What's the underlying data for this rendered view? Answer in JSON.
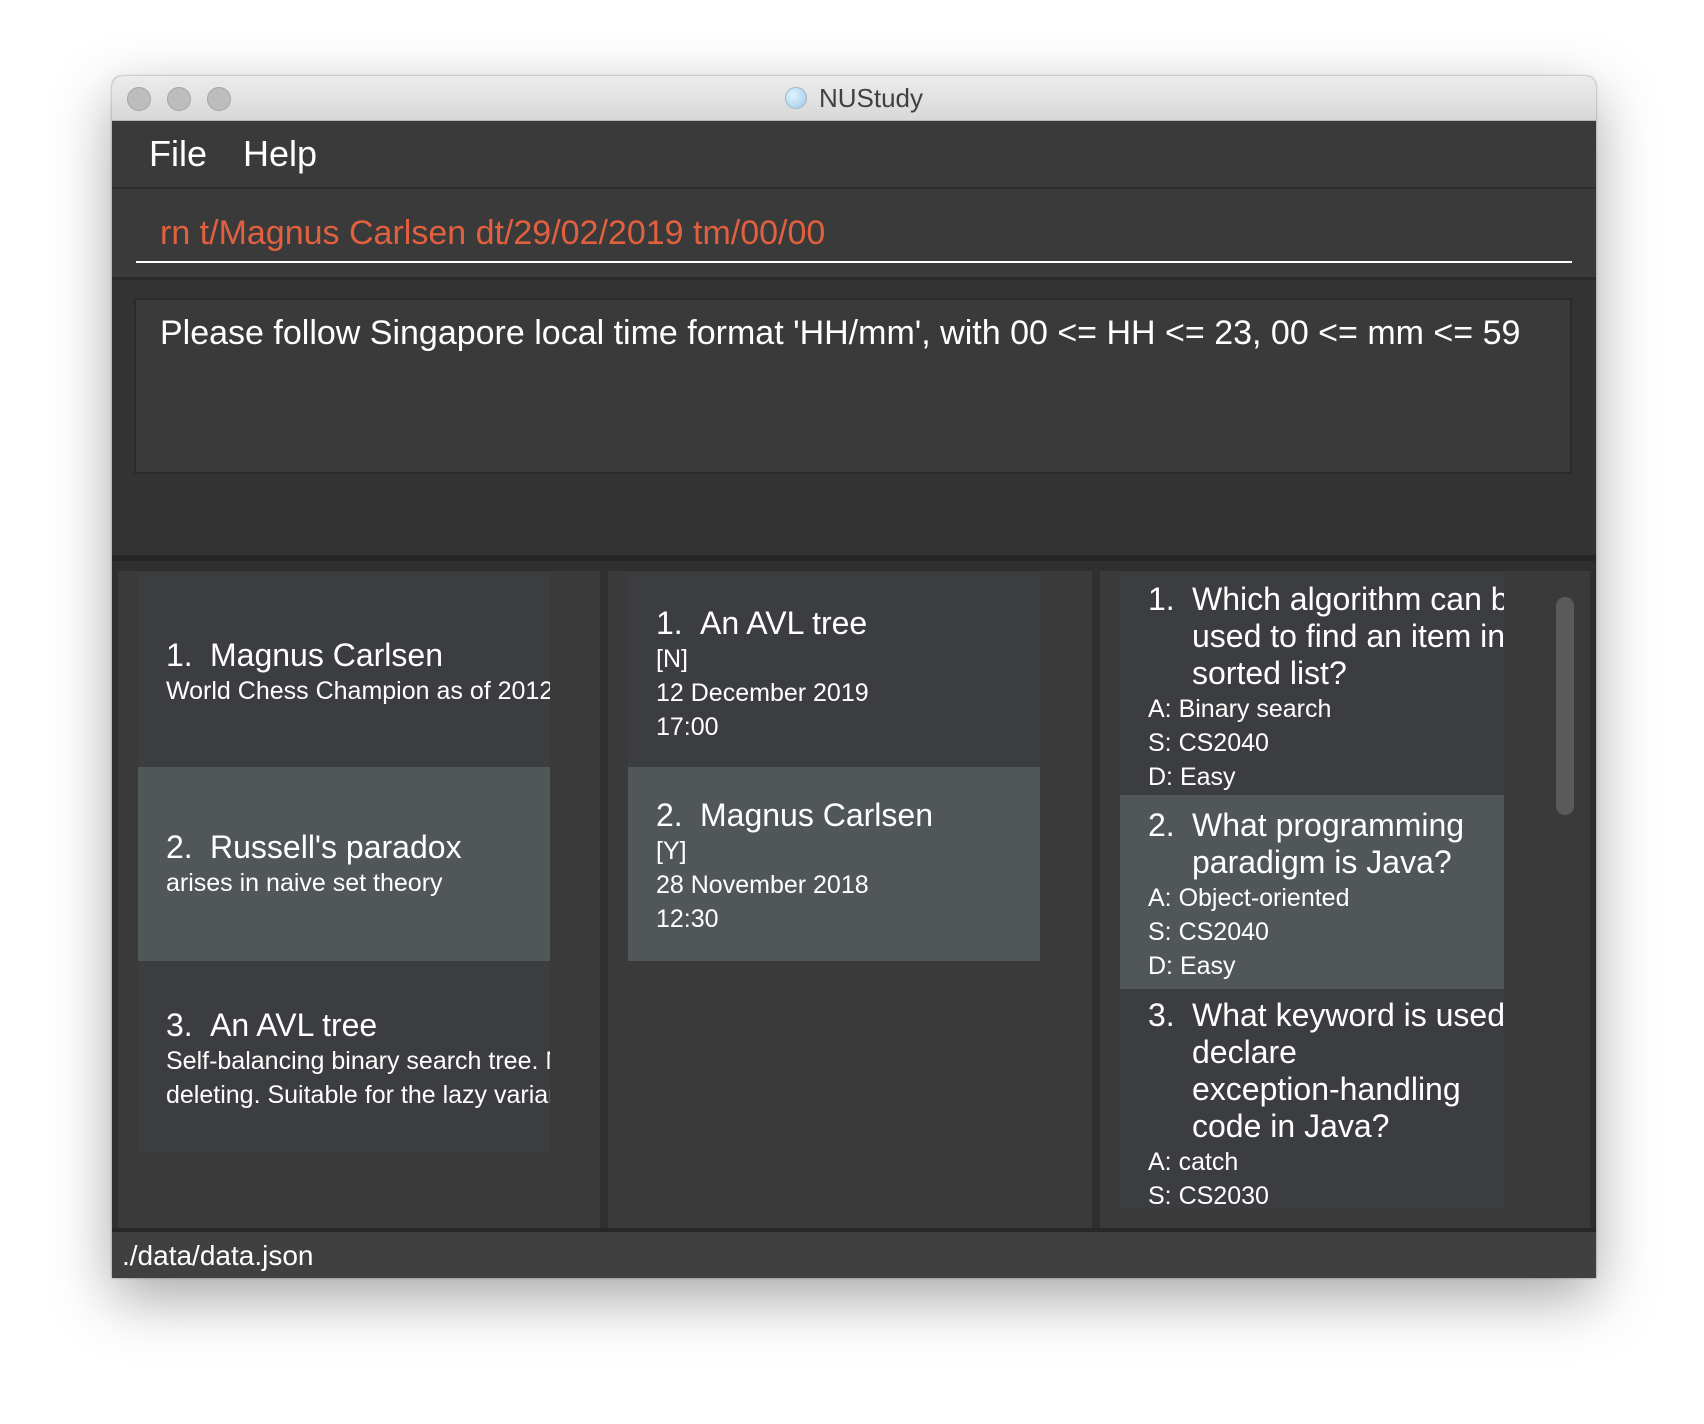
{
  "window": {
    "title": "NUStudy"
  },
  "menu": {
    "file": "File",
    "help": "Help"
  },
  "command": {
    "value": "rn t/Magnus Carlsen dt/29/02/2019 tm/00/00"
  },
  "result": {
    "message": "Please follow Singapore local time format 'HH/mm', with 00 <= HH <= 23, 00 <= mm <= 59"
  },
  "cheatsheet": [
    {
      "index": "1.",
      "title": "Magnus Carlsen",
      "lines": [
        "World Chess Champion as of 2012"
      ]
    },
    {
      "index": "2.",
      "title": "Russell's paradox",
      "lines": [
        "arises in naive set theory"
      ]
    },
    {
      "index": "3.",
      "title": "An AVL tree",
      "lines": [
        "Self-balancing binary search tree. Nee",
        "deleting. Suitable for the lazy variant of"
      ]
    }
  ],
  "revisions": [
    {
      "index": "1.",
      "title": "An AVL tree",
      "lines": [
        "[N]",
        "12 December 2019",
        "17:00"
      ]
    },
    {
      "index": "2.",
      "title": "Magnus Carlsen",
      "lines": [
        "[Y]",
        "28 November 2018",
        "12:30"
      ]
    }
  ],
  "questions": [
    {
      "index": "1.",
      "title_lines": [
        "Which algorithm can be",
        "used to find an item in a",
        "sorted list?"
      ],
      "lines": [
        "A: Binary search",
        "S: CS2040",
        "D: Easy"
      ]
    },
    {
      "index": "2.",
      "title_lines": [
        "What programming",
        "paradigm is Java?"
      ],
      "lines": [
        "A: Object-oriented",
        "S: CS2040",
        "D: Easy"
      ]
    },
    {
      "index": "3.",
      "title_lines": [
        "What keyword is used to",
        "declare",
        "exception-handling",
        "code in Java?"
      ],
      "lines": [
        "A: catch",
        "S: CS2030"
      ]
    }
  ],
  "status": {
    "path": "./data/data.json"
  }
}
